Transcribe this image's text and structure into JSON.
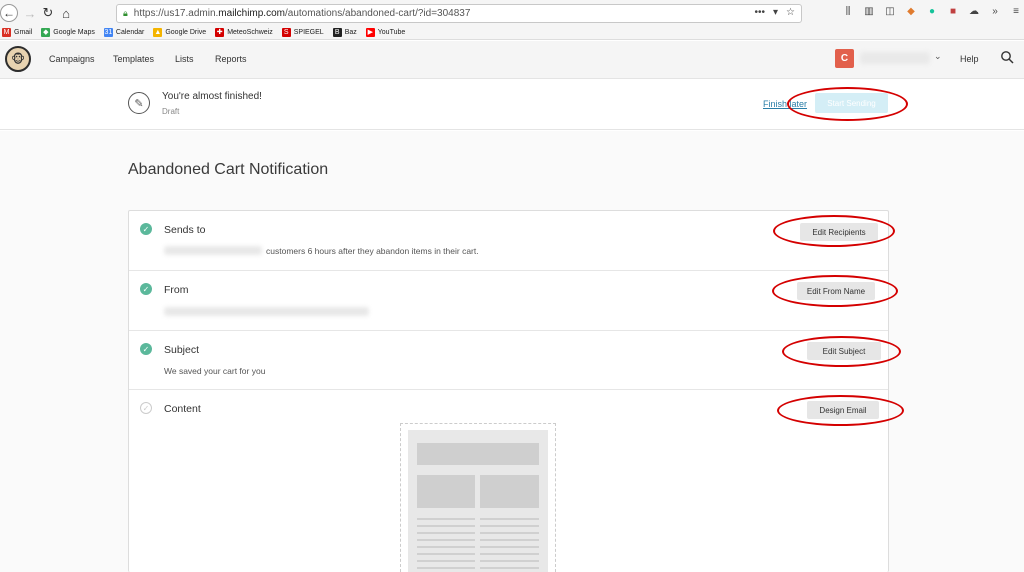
{
  "browser": {
    "url_prefix": "https://us17.admin.",
    "url_domain": "mailchimp.com",
    "url_path": "/automations/abandoned-cart/?id=304837",
    "bookmarks": [
      {
        "label": "Gmail",
        "icon": "M",
        "color": "#d93025"
      },
      {
        "label": "Google Maps",
        "icon": "◆",
        "color": "#34a853"
      },
      {
        "label": "Calendar",
        "icon": "31",
        "color": "#4285f4"
      },
      {
        "label": "Google Drive",
        "icon": "▲",
        "color": "#f4b400"
      },
      {
        "label": "MeteoSchweiz",
        "icon": "✚",
        "color": "#d40000"
      },
      {
        "label": "SPIEGEL",
        "icon": "S",
        "color": "#d40000"
      },
      {
        "label": "Baz",
        "icon": "B",
        "color": "#222222"
      },
      {
        "label": "YouTube",
        "icon": "▶",
        "color": "#ff0000"
      }
    ]
  },
  "nav": {
    "items": [
      "Campaigns",
      "Templates",
      "Lists",
      "Reports"
    ],
    "user_initial": "C",
    "help": "Help"
  },
  "status": {
    "title": "You're almost finished!",
    "subtitle": "Draft",
    "finish_later": "Finish later",
    "start_sending": "Start Sending"
  },
  "page": {
    "title": "Abandoned Cart Notification"
  },
  "sections": {
    "sends_to": {
      "title": "Sends to",
      "desc": "customers 6 hours after they abandon items in their cart.",
      "button": "Edit Recipients"
    },
    "from": {
      "title": "From",
      "button": "Edit From Name"
    },
    "subject": {
      "title": "Subject",
      "desc": "We saved your cart for you",
      "button": "Edit Subject"
    },
    "content": {
      "title": "Content",
      "button": "Design Email"
    }
  },
  "colors": {
    "accent_check": "#5bb89b",
    "highlight": "#d40000",
    "start_sending_bg": "#d4eef6"
  }
}
